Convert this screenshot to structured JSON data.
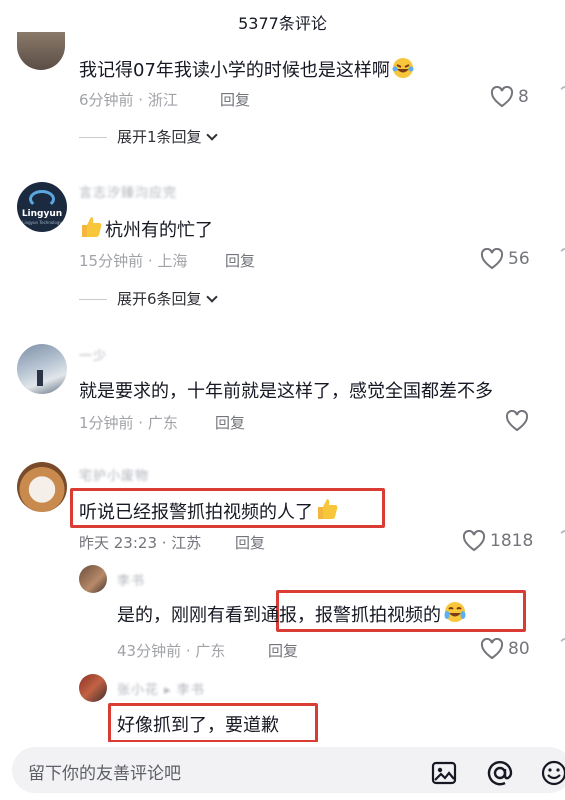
{
  "header": {
    "title": "5377条评论"
  },
  "comments": [
    {
      "text": "我记得07年我读小学的时候也是这样啊",
      "emoji_icon": "laughing-tears-emoji",
      "time_loc": "6分钟前 · 浙江",
      "reply_label": "回复",
      "likes": "8",
      "expand": "展开1条回复"
    },
    {
      "username": "言志汐臻汮应完",
      "avatar_text": "Lingyun",
      "avatar_subtext": "Lingyun Technology",
      "text": "杭州有的忙了",
      "emoji_icon": "thumbs-up-emoji",
      "time_loc": "15分钟前 · 上海",
      "reply_label": "回复",
      "likes": "56",
      "expand": "展开6条回复"
    },
    {
      "username": "一少",
      "text": "就是要求的，十年前就是这样了，感觉全国都差不多",
      "time_loc": "1分钟前 · 广东",
      "reply_label": "回复",
      "likes": ""
    },
    {
      "username": "宅护小废物",
      "text": "听说已经报警抓拍视频的人了",
      "emoji_icon": "thumbs-up-emoji",
      "time_loc": "昨天 23:23 · 江苏",
      "reply_label": "回复",
      "likes": "1818",
      "highlighted": true
    }
  ],
  "replies": [
    {
      "username": "李书",
      "text_part1": "是的，刚刚有看到",
      "text_part2": "通报，报警抓拍视频的",
      "emoji_icon": "crying-laughing-emoji",
      "time_loc": "43分钟前 · 广东",
      "reply_label": "回复",
      "likes": "80",
      "highlighted": true
    },
    {
      "username": "张小花 ▸ 李书",
      "text": "好像抓到了，要道歉",
      "highlighted": true
    }
  ],
  "input": {
    "placeholder": "留下你的友善评论吧"
  },
  "toolbar": {
    "icons": [
      "image-icon",
      "mention-icon",
      "emoji-icon"
    ]
  },
  "colors": {
    "highlight_box": "#d93b35",
    "meta_text": "#a1a3a8"
  }
}
